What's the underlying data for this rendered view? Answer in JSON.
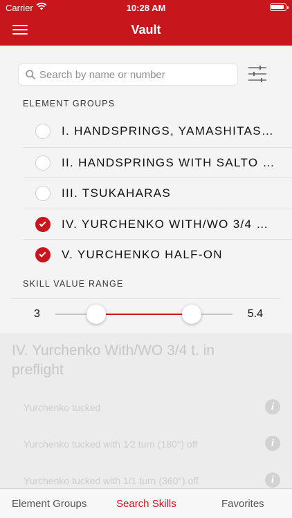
{
  "status_bar": {
    "carrier": "Carrier",
    "time": "10:28 AM"
  },
  "header": {
    "title": "Vault"
  },
  "search": {
    "placeholder": "Search by name or number",
    "value": ""
  },
  "element_groups": {
    "header": "ELEMENT GROUPS",
    "items": [
      {
        "label": "I. HANDSPRINGS, YAMASHITAS…",
        "checked": false
      },
      {
        "label": "II. HANDSPRINGS WITH SALTO …",
        "checked": false
      },
      {
        "label": "III. TSUKAHARAS",
        "checked": false
      },
      {
        "label": "IV. YURCHENKO WITH/WO 3/4 …",
        "checked": true
      },
      {
        "label": "V. YURCHENKO HALF-ON",
        "checked": true
      }
    ]
  },
  "skill_range": {
    "header": "SKILL VALUE RANGE",
    "min_label": "3",
    "max_label": "5.4",
    "low_fraction": 0.23,
    "high_fraction": 0.77
  },
  "results": {
    "title": "IV. Yurchenko With/WO 3/4 t. in preflight",
    "skills": [
      "Yurchenko tucked",
      "Yurchenko tucked with 1⁄2 turn (180°) off",
      "Yurchenko tucked with 1/1 turn (360°) off"
    ]
  },
  "tabs": [
    {
      "label": "Element Groups",
      "active": false
    },
    {
      "label": "Search Skills",
      "active": true
    },
    {
      "label": "Favorites",
      "active": false
    }
  ],
  "colors": {
    "accent": "#c8161d"
  }
}
